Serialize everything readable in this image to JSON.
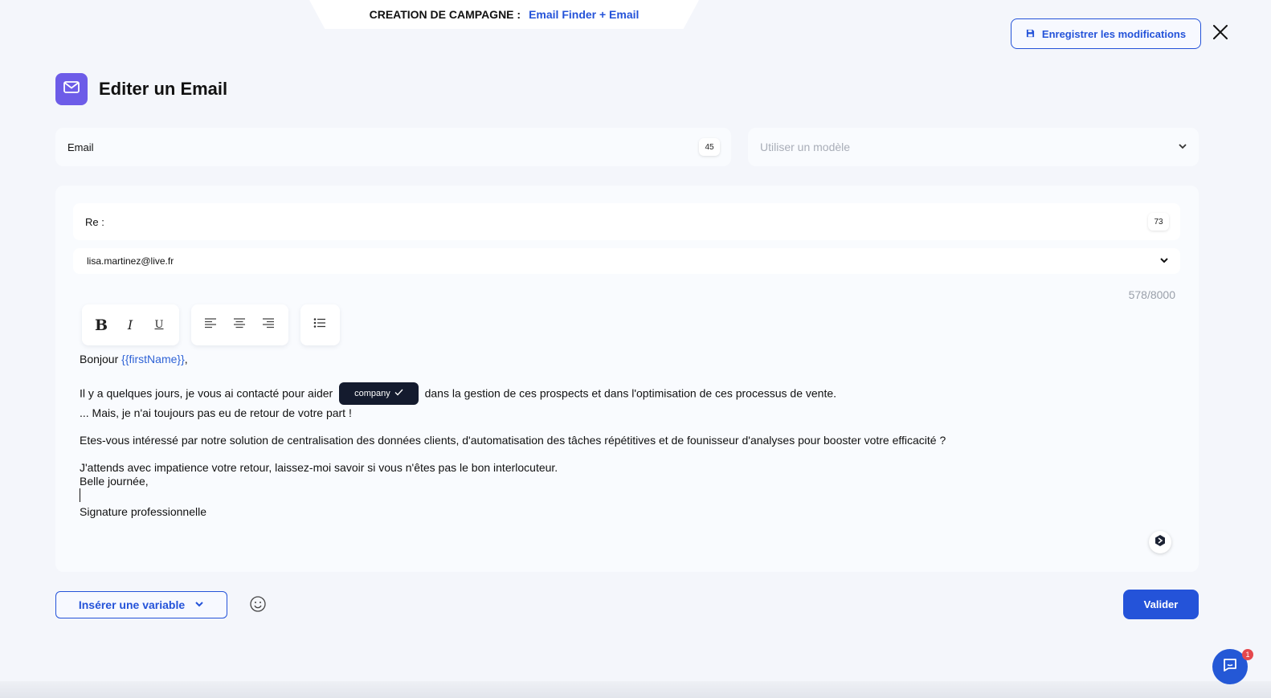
{
  "campaign": {
    "label": "CREATION DE CAMPAGNE :",
    "name": "Email Finder + Email"
  },
  "actions": {
    "save_label": "Enregistrer les modifications",
    "close_icon": "close-icon",
    "save_icon": "floppy-disk-icon"
  },
  "header": {
    "title": "Editer un Email",
    "icon": "envelope-icon"
  },
  "subject": {
    "value": "Email",
    "count": "45"
  },
  "template": {
    "placeholder": "Utiliser un modèle"
  },
  "editor": {
    "re_label": "Re :",
    "re_count": "73",
    "from_value": "lisa.martinez@live.fr",
    "char_count": "578/8000",
    "toolbar": {
      "bold": "B",
      "italic": "I",
      "underline": "U"
    },
    "body": {
      "greeting": "Bonjour",
      "first_name_var": "{{firstName}}",
      "greeting_end": ",",
      "line1_start": "Il y a quelques jours, je vous ai contacté pour aider",
      "company_chip": "company",
      "line1_end": "dans la gestion de ces prospects et dans l'optimisation de ces processus de vente.",
      "line2": "... Mais, je n'ai toujours pas eu de retour de votre part !",
      "line3": "Etes-vous intéressé par notre solution de centralisation des données clients, d'automatisation des tâches répétitives et de founisseur d'analyses pour booster votre efficacité ?",
      "line4": "J'attends avec impatience votre retour, laissez-moi savoir si vous n'êtes pas le bon interlocuteur.",
      "line5": "Belle journée,",
      "signature": "Signature professionnelle"
    }
  },
  "footer": {
    "insert_variable": "Insérer une variable",
    "validate": "Valider",
    "chat_badge": "1"
  },
  "colors": {
    "accent": "#2453d9",
    "header_icon_bg": "#6d5ce8",
    "chip_bg": "#141b2e",
    "variable_text": "#2f63d6",
    "notification": "#e5484d"
  }
}
